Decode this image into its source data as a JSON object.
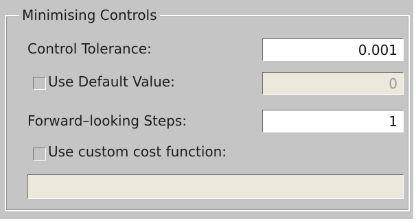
{
  "group": {
    "title": "Minimising Controls"
  },
  "control_tolerance": {
    "label": "Control Tolerance:",
    "value": "0.001"
  },
  "use_default_value": {
    "label": "Use Default Value:",
    "checked": false,
    "value": "0"
  },
  "forward_looking_steps": {
    "label": "Forward–looking Steps:",
    "value": "1"
  },
  "use_custom_cost_function": {
    "label": "Use custom cost function:",
    "checked": false,
    "value": ""
  },
  "colors": {
    "panel_background": "#c5c5c5",
    "field_active": "#ffffff",
    "field_disabled": "#ece8dc"
  }
}
